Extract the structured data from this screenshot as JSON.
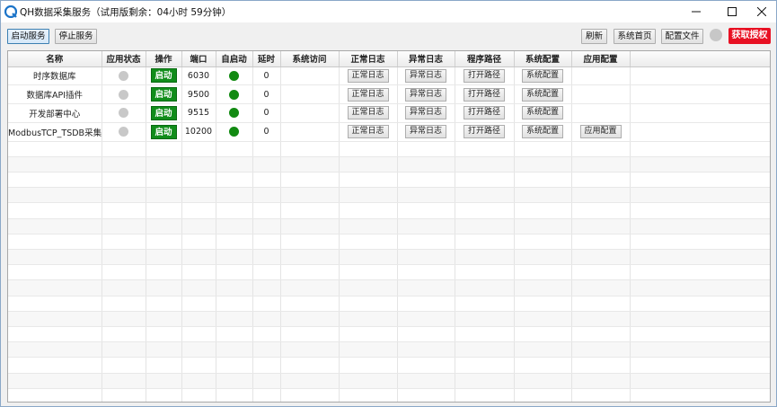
{
  "window": {
    "title": "QH数据采集服务（试用版剩余：04小时 59分钟）"
  },
  "toolbar": {
    "start_service": "启动服务",
    "stop_service": "停止服务",
    "refresh": "刷新",
    "system_home": "系统首页",
    "config_file": "配置文件",
    "get_license": "获取授权",
    "license_color": "#e81123"
  },
  "table": {
    "headers": [
      "名称",
      "应用状态",
      "操作",
      "端口",
      "自启动",
      "延时",
      "系统访问",
      "正常日志",
      "异常日志",
      "程序路径",
      "系统配置",
      "应用配置"
    ],
    "rows": [
      {
        "name": "时序数据库",
        "status": "stopped",
        "action": "启动",
        "port": "6030",
        "autostart": "on",
        "delay": "0",
        "access": "",
        "normal_log": "正常日志",
        "error_log": "异常日志",
        "path": "打开路径",
        "sys_config": "系统配置",
        "app_config": ""
      },
      {
        "name": "数据库API插件",
        "status": "stopped",
        "action": "启动",
        "port": "9500",
        "autostart": "on",
        "delay": "0",
        "access": "",
        "normal_log": "正常日志",
        "error_log": "异常日志",
        "path": "打开路径",
        "sys_config": "系统配置",
        "app_config": ""
      },
      {
        "name": "开发部署中心",
        "status": "stopped",
        "action": "启动",
        "port": "9515",
        "autostart": "on",
        "delay": "0",
        "access": "",
        "normal_log": "正常日志",
        "error_log": "异常日志",
        "path": "打开路径",
        "sys_config": "系统配置",
        "app_config": ""
      },
      {
        "name": "ModbusTCP_TSDB采集",
        "status": "stopped",
        "action": "启动",
        "port": "10200",
        "autostart": "on",
        "delay": "0",
        "access": "",
        "normal_log": "正常日志",
        "error_log": "异常日志",
        "path": "打开路径",
        "sys_config": "系统配置",
        "app_config": "应用配置"
      }
    ]
  },
  "icons": {
    "app_logo": "qh-logo-icon",
    "minimize": "minimize-icon",
    "maximize": "maximize-icon",
    "close": "close-icon"
  },
  "colors": {
    "run_button": "#118d1b",
    "autostart_on": "#128a12",
    "status_stopped": "#c8c8c8"
  }
}
